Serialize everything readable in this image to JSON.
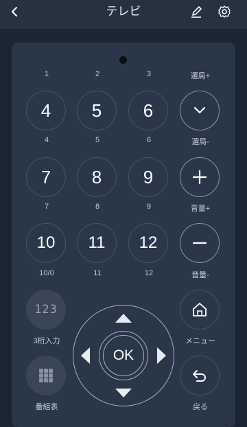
{
  "header": {
    "title": "テレビ",
    "icons": [
      "back-icon",
      "edit-icon",
      "gear-icon"
    ]
  },
  "rows": [
    {
      "labels_above": [
        "1",
        "2",
        "3",
        "選局+"
      ],
      "buttons": [
        "4",
        "5",
        "6"
      ],
      "labels_below": [
        "4",
        "5",
        "6",
        "選局-"
      ]
    },
    {
      "buttons": [
        "7",
        "8",
        "9"
      ],
      "labels_below": [
        "7",
        "8",
        "9",
        "音量+"
      ]
    },
    {
      "buttons": [
        "10",
        "11",
        "12"
      ],
      "labels_below": [
        "10/0",
        "11",
        "12",
        "音量-"
      ]
    }
  ],
  "extra": {
    "three_digit_label": "3桁入力",
    "three_digit_glyph": "123",
    "guide_label": "番組表",
    "menu_label": "メニュー",
    "back_label": "戻る"
  },
  "dpad": {
    "ok_label": "OK"
  },
  "colors": {
    "background": "#1b2533",
    "panel": "#2a3748",
    "header": "#26323f"
  }
}
